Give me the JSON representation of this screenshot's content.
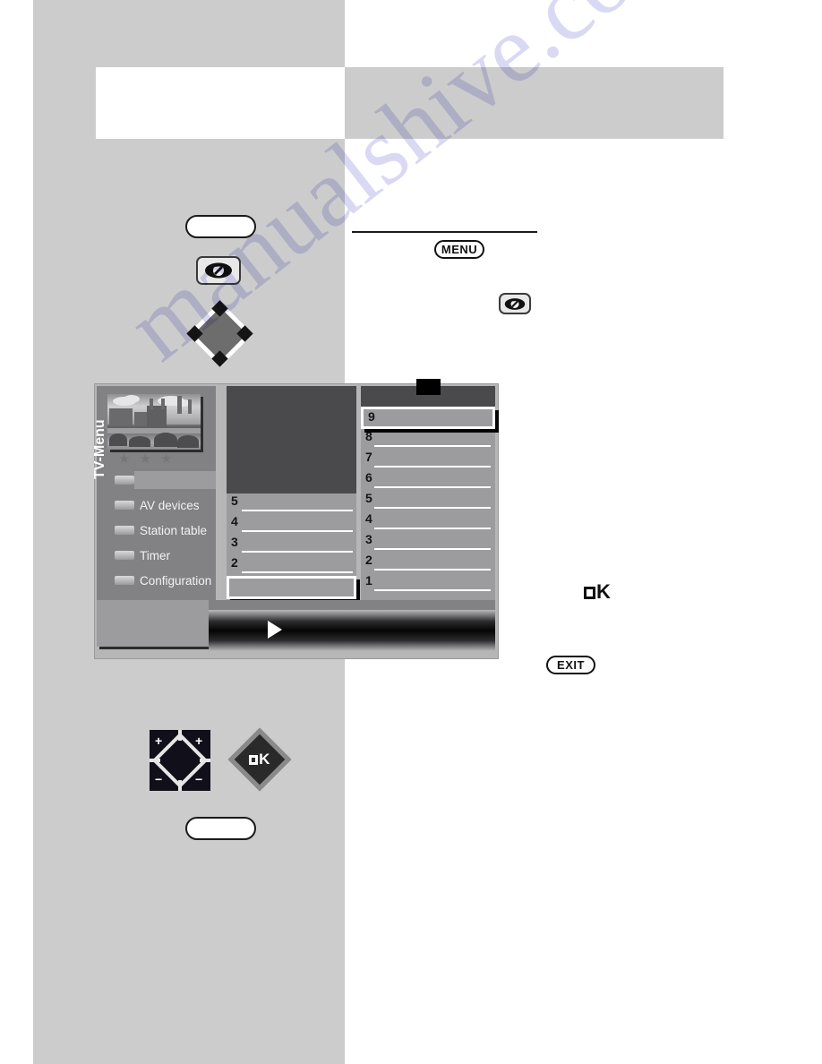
{
  "page": {
    "watermark": "manualshive.com",
    "background_color": "#ffffff",
    "sidebar_color": "#cccccc"
  },
  "remote_keys": {
    "oval_top_label": "",
    "oval_bottom_label": "",
    "eye_icon_name": "eye-button-icon",
    "nav_diamond_name": "navigation-diamond-icon",
    "menu_label": "MENU",
    "exit_label": "EXIT",
    "ok_label": "OK",
    "ok_diamond_label": "OK",
    "pad_plus_left": "+",
    "pad_plus_right": "+",
    "pad_minus_left": "−",
    "pad_minus_right": "−"
  },
  "osd": {
    "vertical_label": "TV-Menu",
    "stars": [
      "★",
      "★",
      "★"
    ],
    "menu_items": [
      {
        "label": "",
        "blank": true
      },
      {
        "label": "AV devices",
        "blank": false
      },
      {
        "label": "Station table",
        "blank": false
      },
      {
        "label": "Timer",
        "blank": false
      },
      {
        "label": "Configuration",
        "blank": false
      }
    ],
    "middle_column": {
      "rows": [
        {
          "num": "5",
          "selected": false
        },
        {
          "num": "4",
          "selected": false
        },
        {
          "num": "3",
          "selected": false
        },
        {
          "num": "2",
          "selected": false
        },
        {
          "num": "",
          "selected": true
        }
      ]
    },
    "right_column": {
      "rows": [
        {
          "num": "9",
          "selected": true
        },
        {
          "num": "8",
          "selected": false
        },
        {
          "num": "7",
          "selected": false
        },
        {
          "num": "6",
          "selected": false
        },
        {
          "num": "5",
          "selected": false
        },
        {
          "num": "4",
          "selected": false
        },
        {
          "num": "3",
          "selected": false
        },
        {
          "num": "2",
          "selected": false
        },
        {
          "num": "1",
          "selected": false
        }
      ]
    },
    "bottom_bar_icon": "play-arrow-icon"
  }
}
